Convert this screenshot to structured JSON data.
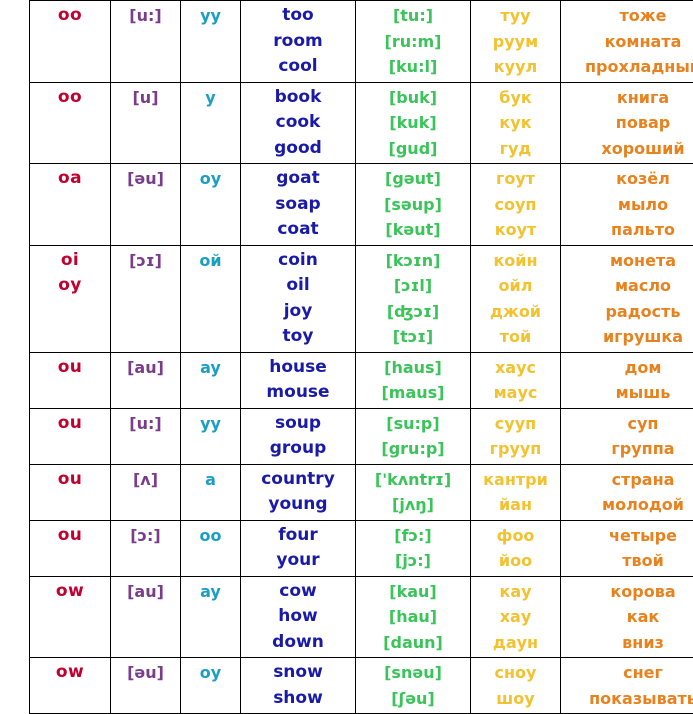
{
  "table": {
    "columns": [
      {
        "key": "letters",
        "role": "spelling-pattern"
      },
      {
        "key": "phonetic",
        "role": "ipa-transcription"
      },
      {
        "key": "sound",
        "role": "russian-sound-approximation"
      },
      {
        "key": "word",
        "role": "english-word"
      },
      {
        "key": "trans",
        "role": "word-ipa-transcription"
      },
      {
        "key": "translit",
        "role": "russian-transliteration"
      },
      {
        "key": "meaning",
        "role": "russian-translation"
      }
    ],
    "colors": {
      "letters": "#c2002f",
      "phonetic": "#7a3d8a",
      "sound": "#1a9ec4",
      "word": "#1a1aa8",
      "trans": "#3ac45a",
      "translit": "#f2c230",
      "meaning": "#e8821e",
      "border": "#000000",
      "background": "#ffffff"
    },
    "rows": [
      {
        "letters": [
          "oo"
        ],
        "phonetic": [
          "[u:]"
        ],
        "sound": [
          "уу"
        ],
        "word": [
          "too",
          "room",
          "cool"
        ],
        "trans": [
          "[tu:]",
          "[ru:m]",
          "[ku:l]"
        ],
        "translit": [
          "туу",
          "руум",
          "куул"
        ],
        "meaning": [
          "тоже",
          "комната",
          "прохладный"
        ]
      },
      {
        "letters": [
          "oo"
        ],
        "phonetic": [
          "[u]"
        ],
        "sound": [
          "у"
        ],
        "word": [
          "book",
          "cook",
          "good"
        ],
        "trans": [
          "[buk]",
          "[kuk]",
          "[gud]"
        ],
        "translit": [
          "бук",
          "кук",
          "гуд"
        ],
        "meaning": [
          "книга",
          "повар",
          "хороший"
        ]
      },
      {
        "letters": [
          "oa"
        ],
        "phonetic": [
          "[əu]"
        ],
        "sound": [
          "оу"
        ],
        "word": [
          "goat",
          "soap",
          "coat"
        ],
        "trans": [
          "[gəut]",
          "[səup]",
          "[kəut]"
        ],
        "translit": [
          "гоут",
          "соуп",
          "коут"
        ],
        "meaning": [
          "козёл",
          "мыло",
          "пальто"
        ]
      },
      {
        "letters": [
          "oi",
          "oy"
        ],
        "phonetic": [
          "[ɔɪ]"
        ],
        "sound": [
          "ой"
        ],
        "word": [
          "coin",
          "oil",
          "joy",
          "toy"
        ],
        "trans": [
          "[kɔɪn]",
          "[ɔɪl]",
          "[ʤɔɪ]",
          "[tɔɪ]"
        ],
        "translit": [
          "койн",
          "ойл",
          "джой",
          "той"
        ],
        "meaning": [
          "монета",
          "масло",
          "радость",
          "игрушка"
        ]
      },
      {
        "letters": [
          "ou"
        ],
        "phonetic": [
          "[au]"
        ],
        "sound": [
          "ay"
        ],
        "word": [
          "house",
          "mouse"
        ],
        "trans": [
          "[haus]",
          "[maus]"
        ],
        "translit": [
          "хаус",
          "маус"
        ],
        "meaning": [
          "дом",
          "мышь"
        ]
      },
      {
        "letters": [
          "ou"
        ],
        "phonetic": [
          "[u:]"
        ],
        "sound": [
          "уу"
        ],
        "word": [
          "soup",
          "group"
        ],
        "trans": [
          "[su:p]",
          "[gru:p]"
        ],
        "translit": [
          "сууп",
          "грууп"
        ],
        "meaning": [
          "суп",
          "группа"
        ]
      },
      {
        "letters": [
          "ou"
        ],
        "phonetic": [
          "[ʌ]"
        ],
        "sound": [
          "а"
        ],
        "word": [
          "country",
          "young"
        ],
        "trans": [
          "['kʌntrɪ]",
          "[jʌŋ]"
        ],
        "translit": [
          "кантри",
          "йан"
        ],
        "meaning": [
          "страна",
          "молодой"
        ]
      },
      {
        "letters": [
          "ou"
        ],
        "phonetic": [
          "[ɔ:]"
        ],
        "sound": [
          "оо"
        ],
        "word": [
          "four",
          "your"
        ],
        "trans": [
          "[fɔ:]",
          "[jɔ:]"
        ],
        "translit": [
          "фоо",
          "йоо"
        ],
        "meaning": [
          "четыре",
          "твой"
        ]
      },
      {
        "letters": [
          "ow"
        ],
        "phonetic": [
          "[au]"
        ],
        "sound": [
          "ay"
        ],
        "word": [
          "cow",
          "how",
          "down"
        ],
        "trans": [
          "[kau]",
          "[hau]",
          "[daun]"
        ],
        "translit": [
          "кау",
          "хау",
          "даун"
        ],
        "meaning": [
          "корова",
          "как",
          "вниз"
        ]
      },
      {
        "letters": [
          "ow"
        ],
        "phonetic": [
          "[əu]"
        ],
        "sound": [
          "оу"
        ],
        "word": [
          "snow",
          "show"
        ],
        "trans": [
          "[snəu]",
          "[ʃəu]"
        ],
        "translit": [
          "сноу",
          "шоу"
        ],
        "meaning": [
          "снег",
          "показывать"
        ]
      }
    ]
  }
}
